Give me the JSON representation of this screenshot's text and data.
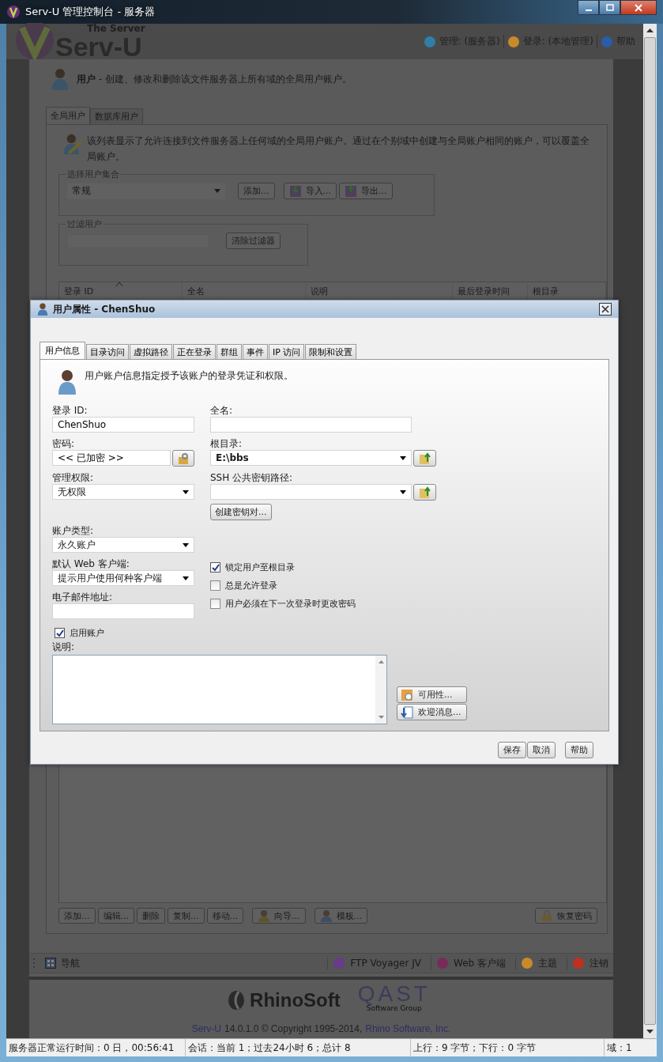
{
  "window": {
    "title": "Serv-U 管理控制台 - 服务器"
  },
  "header": {
    "logo_tagline": "The Server",
    "logo": "Serv-U",
    "links": [
      {
        "label": "管理: (服务器)",
        "kind": "manage"
      },
      {
        "label": "登录: (本地管理)",
        "kind": "login"
      },
      {
        "label": "帮助",
        "kind": "help"
      }
    ]
  },
  "page_heading": "**用户** - 创建、修改和删除该文件服务器上所有域的全局用户账户。",
  "tabs": [
    {
      "label": "全局用户",
      "selected": true
    },
    {
      "label": "数据库用户",
      "selected": false
    }
  ],
  "description": "该列表显示了允许连接到文件服务器上任何域的全局用户账户。通过在个别域中创建与全局账户相同的账户，可以覆盖全局账户。",
  "user_collection": {
    "legend": "选择用户集合",
    "value": "常规",
    "buttons": [
      {
        "label": "添加...",
        "kind": "plain"
      },
      {
        "label": "导入...",
        "kind": "import"
      },
      {
        "label": "导出...",
        "kind": "export"
      }
    ]
  },
  "filter": {
    "legend": "过滤用户",
    "button": "清除过滤器"
  },
  "table": {
    "columns": [
      {
        "label": "登录 ID",
        "sorted": true
      },
      {
        "label": "全名",
        "sorted": false
      },
      {
        "label": "说明",
        "sorted": false
      },
      {
        "label": "最后登录时间",
        "sorted": false
      },
      {
        "label": "根目录",
        "sorted": false
      }
    ]
  },
  "list_buttons": [
    {
      "label": "添加...",
      "kind": "plain"
    },
    {
      "label": "编辑...",
      "kind": "plain"
    },
    {
      "label": "删除",
      "kind": "plain"
    },
    {
      "label": "复制...",
      "kind": "plain"
    },
    {
      "label": "移动...",
      "kind": "plain"
    },
    {
      "label": "向导...",
      "kind": "wizard"
    },
    {
      "label": "模板...",
      "kind": "template"
    }
  ],
  "recover_button": "恢复密码",
  "toolbar": {
    "nav": "导航",
    "items": [
      {
        "label": "FTP Voyager JV",
        "kind": "ftp"
      },
      {
        "label": "Web 客户端",
        "kind": "web"
      },
      {
        "label": "主题",
        "kind": "theme"
      },
      {
        "label": "注销",
        "kind": "logout"
      }
    ]
  },
  "footer": {
    "brand": "RhinoSoft",
    "partner": "QAST",
    "partner_sub": "Software Group",
    "product": "Serv-U",
    "copyright": "14.0.1.0 © Copyright 1995-2014,",
    "company": "Rhino Software, Inc."
  },
  "dialog": {
    "title": "用户属性 - ChenShuo",
    "tabs": [
      {
        "label": "用户信息",
        "selected": true
      },
      {
        "label": "目录访问",
        "selected": false
      },
      {
        "label": "虚拟路径",
        "selected": false
      },
      {
        "label": "正在登录",
        "selected": false
      },
      {
        "label": "群组",
        "selected": false
      },
      {
        "label": "事件",
        "selected": false
      },
      {
        "label": "IP 访问",
        "selected": false
      },
      {
        "label": "限制和设置",
        "selected": false
      }
    ],
    "intro": "用户账户信息指定授予该账户的登录凭证和权限。",
    "login_id": {
      "label": "登录 ID:",
      "value": "ChenShuo"
    },
    "full_name": {
      "label": "全名:"
    },
    "password": {
      "label": "密码:",
      "value": "<< 已加密 >>"
    },
    "root_dir": {
      "label": "根目录:",
      "value": "E:\\bbs"
    },
    "admin": {
      "label": "管理权限:",
      "value": "无权限"
    },
    "ssh_key": {
      "label": "SSH 公共密钥路径:"
    },
    "create_key": "创建密钥对...",
    "account_type": {
      "label": "账户类型:",
      "value": "永久账户"
    },
    "web_client": {
      "label": "默认 Web 客户端:",
      "value": "提示用户使用何种客户端"
    },
    "email": {
      "label": "电子邮件地址:"
    },
    "enable_account": {
      "label": "启用账户",
      "checked": true
    },
    "options": [
      {
        "label": "锁定用户至根目录",
        "checked": true
      },
      {
        "label": "总是允许登录",
        "checked": false
      },
      {
        "label": "用户必须在下一次登录时更改密码",
        "checked": false
      }
    ],
    "notes": {
      "label": "说明:"
    },
    "availability": "可用性...",
    "welcome": "欢迎消息...",
    "buttons": [
      "保存",
      "取消",
      "帮助"
    ]
  },
  "status_bar": [
    "服务器正常运行时间：0 日，00:56:41",
    "会话：当前 1；过去24小时 6；总计 8",
    "上行：9 字节；下行：0 字节",
    "域：1"
  ]
}
